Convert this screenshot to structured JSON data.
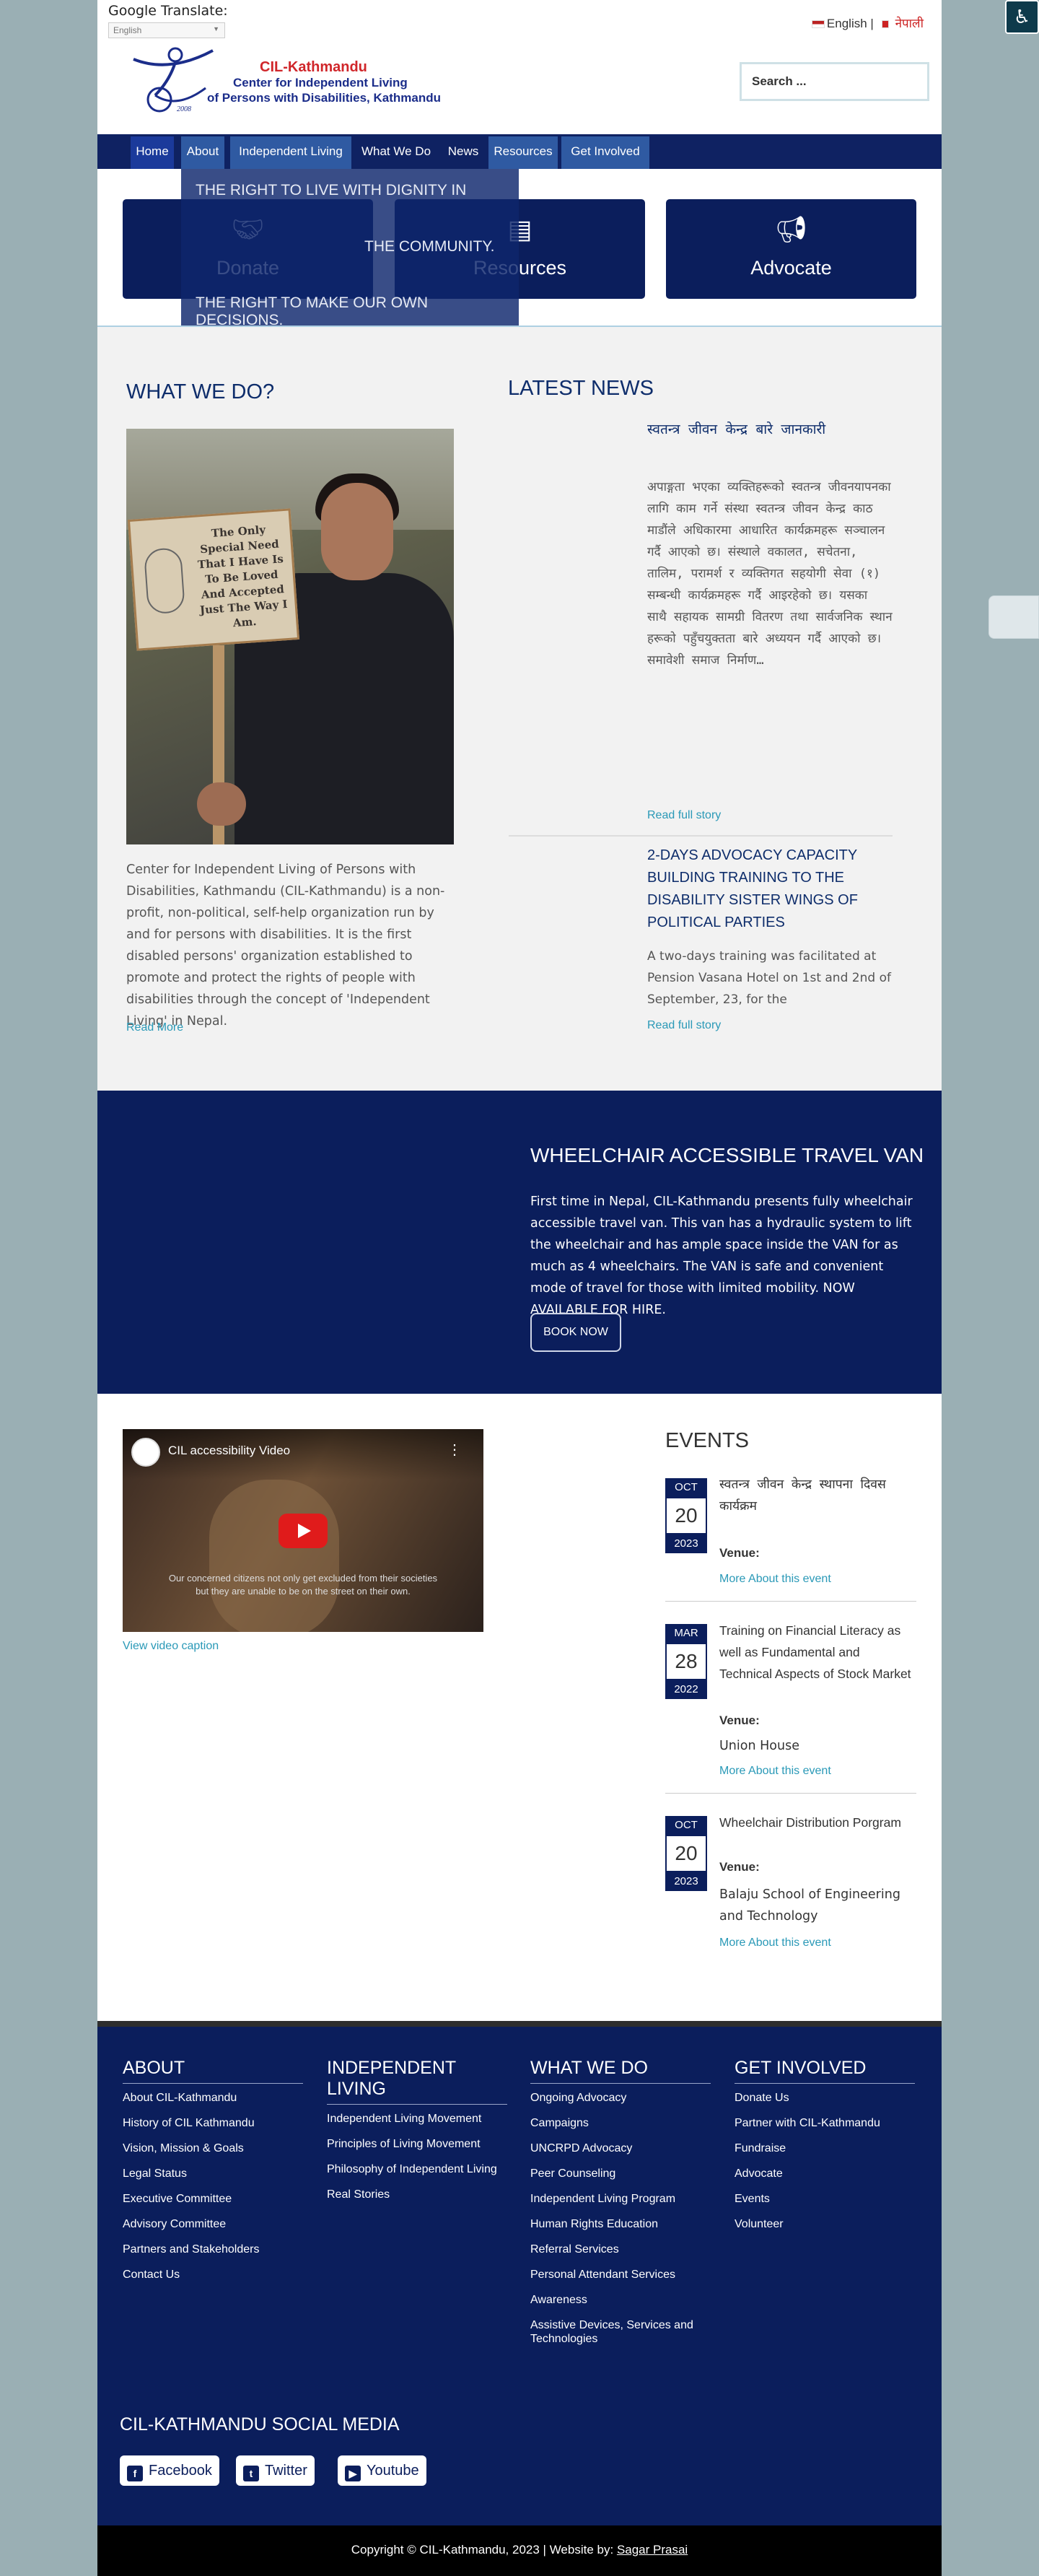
{
  "header": {
    "translate_label": "Google Translate:",
    "language_select": "English",
    "lang_english": "English |",
    "lang_nepali": "नेपाली",
    "logo_year": "2008",
    "logo_title": "CIL-Kathmandu",
    "logo_sub1": "Center for Independent Living",
    "logo_sub2": "of Persons with Disabilities, Kathmandu",
    "search_placeholder": "Search ..."
  },
  "nav": {
    "items": [
      "Home",
      "About",
      "Independent Living",
      "What We Do",
      "News",
      "Resources",
      "Get Involved"
    ]
  },
  "dropdown": {
    "lines": [
      "THE RIGHT TO LIVE WITH DIGNITY IN",
      "THE COMMUNITY.",
      "THE RIGHT TO MAKE OUR OWN DECISIONS."
    ]
  },
  "cards": [
    {
      "label": "Donate",
      "icon": "handshake-icon"
    },
    {
      "label": "Resources",
      "icon": "book-icon"
    },
    {
      "label": "Advocate",
      "icon": "megaphone-icon"
    }
  ],
  "what_we_do": {
    "heading": "WHAT WE DO?",
    "sign_text": "The Only Special Need That I Have Is To Be Loved And Accepted Just The Way I Am.",
    "text": "Center for Independent Living of Persons with Disabilities, Kathmandu (CIL-Kathmandu) is a non-profit, non-political, self-help organization run by and for persons with disabilities. It is the first disabled persons' organization established to promote and protect the rights of people with disabilities through the concept of 'Independent Living' in Nepal.",
    "read_more": "Read More"
  },
  "news": {
    "heading": "LATEST NEWS",
    "items": [
      {
        "title": "स्वतन्त्र जीवन केन्द्र बारे जानकारी",
        "excerpt": "अपाङ्गता भएका व्यक्तिहरूको स्वतन्त्र जीवनयापनका लागि काम गर्ने संस्था स्वतन्त्र जीवन केन्द्र काठमाडौंले अधिकारमा आधारित कार्यक्रमहरू सञ्चालन गर्दै आएको छ। संस्थाले वकालत, सचेतना, तालिम, परामर्श र व्यक्तिगत सहयोगी सेवा (१) सम्बन्धी कार्यक्रमहरू गर्दै आइरहेको छ। यसका साथै सहायक सामग्री वितरण तथा सार्वजनिक स्थानहरूको पहुँचयुक्तता बारे अध्ययन गर्दै आएको छ। समावेशी समाज निर्माण…",
        "link": "Read full story"
      },
      {
        "title": "2-DAYS ADVOCACY CAPACITY BUILDING TRAINING TO THE DISABILITY SISTER WINGS OF POLITICAL PARTIES",
        "excerpt": "A two-days training was facilitated at Pension Vasana Hotel on 1st and 2nd of September, 23, for the",
        "link": "Read full story"
      }
    ]
  },
  "van": {
    "title": "WHEELCHAIR ACCESSIBLE TRAVEL VAN",
    "text": "First time in Nepal, CIL-Kathmandu presents fully wheelchair accessible travel van. This van has a hydraulic system to lift the wheelchair and has ample space inside the VAN for as much as 4 wheelchairs. The VAN is safe and convenient mode of travel for those with limited mobility. NOW AVAILABLE FOR HIRE.",
    "button": "BOOK NOW"
  },
  "video": {
    "title": "CIL accessibility Video",
    "subtitle": "Our concerned citizens not only get excluded from their societies but they are unable to be on the street on their own.",
    "caption_link": "View video caption"
  },
  "events": {
    "heading": "EVENTS",
    "venue_label": "Venue:",
    "more_label": "More About this event",
    "items": [
      {
        "month": "OCT",
        "day": "20",
        "year": "2023",
        "title": "स्वतन्त्र जीवन केन्द्र स्थापना दिवस कार्यक्रम",
        "venue": ""
      },
      {
        "month": "MAR",
        "day": "28",
        "year": "2022",
        "title": "Training on Financial Literacy as well as Fundamental and Technical Aspects of Stock Market",
        "venue": "Union House"
      },
      {
        "month": "OCT",
        "day": "20",
        "year": "2023",
        "title": "Wheelchair Distribution Porgram",
        "venue": "Balaju School of Engineering and Technology"
      }
    ]
  },
  "footer": {
    "columns": [
      {
        "heading": "ABOUT",
        "links": [
          "About CIL-Kathmandu",
          "History of CIL Kathmandu",
          "Vision, Mission & Goals",
          "Legal Status",
          "Executive Committee",
          "Advisory Committee",
          "Partners and Stakeholders",
          "Contact Us"
        ]
      },
      {
        "heading": "INDEPENDENT LIVING",
        "links": [
          "Independent Living Movement",
          "Principles of Living Movement",
          "Philosophy of Independent Living",
          "Real Stories"
        ]
      },
      {
        "heading": "WHAT WE DO",
        "links": [
          "Ongoing Advocacy",
          "Campaigns",
          "UNCRPD Advocacy",
          "Peer Counseling",
          "Independent Living Program",
          "Human Rights Education",
          "Referral Services",
          "Personal Attendant Services",
          "Awareness",
          "Assistive Devices, Services and Technologies"
        ]
      },
      {
        "heading": "GET INVOLVED",
        "links": [
          "Donate Us",
          "Partner with CIL-Kathmandu",
          "Fundraise",
          "Advocate",
          "Events",
          "Volunteer"
        ]
      }
    ],
    "social_heading": "CIL-KATHMANDU SOCIAL MEDIA",
    "social": [
      "Facebook",
      "Twitter",
      "Youtube"
    ],
    "copyright": "Copyright © CIL-Kathmandu, 2023 | Website by:",
    "credit": "Sagar Prasai"
  }
}
